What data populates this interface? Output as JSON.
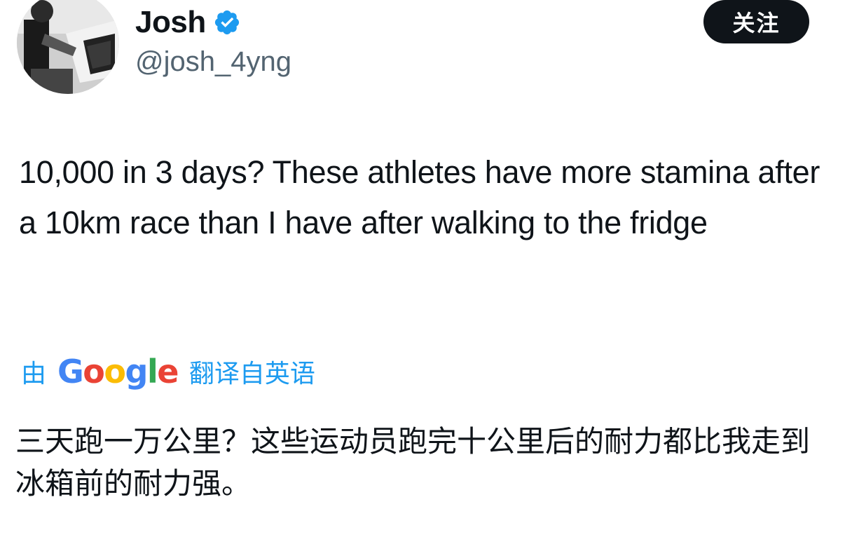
{
  "author": {
    "display_name": "Josh",
    "handle": "@josh_4yng",
    "verified": true,
    "avatar_icon": "avatar-photo"
  },
  "actions": {
    "follow_label": "关注"
  },
  "tweet": {
    "text": "10,000 in 3 days? These athletes have more stamina after a 10km race than I have after walking to the fridge"
  },
  "translation": {
    "prefix": "由",
    "provider_letters": [
      "G",
      "o",
      "o",
      "g",
      "l",
      "e"
    ],
    "provider_colors": [
      "#4285F4",
      "#EA4335",
      "#FBBC05",
      "#4285F4",
      "#34A853",
      "#EA4335"
    ],
    "suffix": "翻译自英语",
    "text": "三天跑一万公里？这些运动员跑完十公里后的耐力都比我走到冰箱前的耐力强。"
  },
  "colors": {
    "accent": "#1d9bf0",
    "verified_badge": "#1d9bf0",
    "text_primary": "#0f1419",
    "text_secondary": "#536471",
    "follow_bg": "#0f1419"
  }
}
